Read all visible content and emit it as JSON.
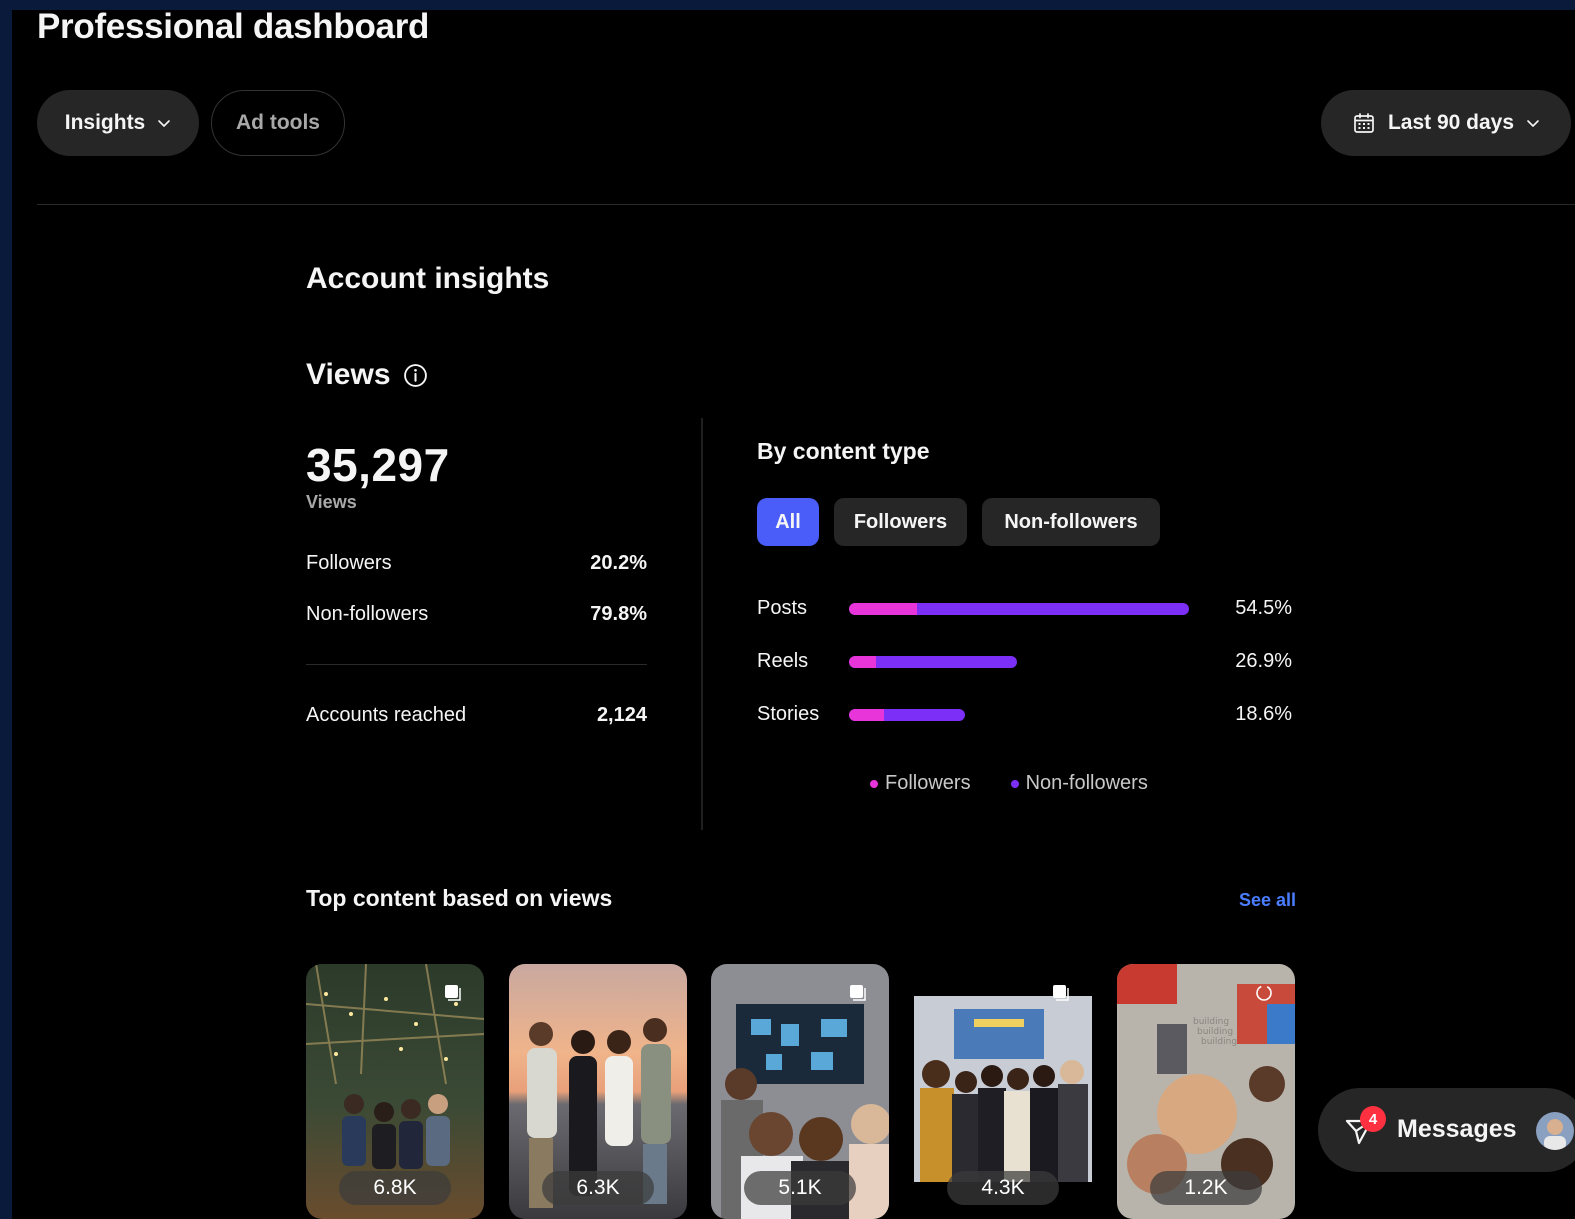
{
  "header": {
    "title": "Professional dashboard"
  },
  "nav": {
    "insights_label": "Insights",
    "ad_tools_label": "Ad tools",
    "date_range_label": "Last 90 days"
  },
  "account_insights": {
    "heading": "Account insights"
  },
  "views": {
    "heading": "Views",
    "total": "35,297",
    "total_label": "Views",
    "rows": [
      {
        "label": "Followers",
        "value": "20.2%"
      },
      {
        "label": "Non-followers",
        "value": "79.8%"
      }
    ],
    "reached": {
      "label": "Accounts reached",
      "value": "2,124"
    }
  },
  "by_content_type": {
    "heading": "By content type",
    "filters": [
      {
        "label": "All",
        "active": true
      },
      {
        "label": "Followers",
        "active": false
      },
      {
        "label": "Non-followers",
        "active": false
      }
    ],
    "rows": [
      {
        "label": "Posts",
        "value": "54.5%",
        "percent": 54.5,
        "followers_share": 0.2
      },
      {
        "label": "Reels",
        "value": "26.9%",
        "percent": 26.9,
        "followers_share": 0.16
      },
      {
        "label": "Stories",
        "value": "18.6%",
        "percent": 18.6,
        "followers_share": 0.3
      }
    ],
    "legend": [
      {
        "label": "Followers",
        "color": "#e835d9"
      },
      {
        "label": "Non-followers",
        "color": "#7b2ff7"
      }
    ]
  },
  "top_content": {
    "heading": "Top content based on views",
    "see_all_label": "See all",
    "items": [
      {
        "count": "6.8K",
        "type_icon": "carousel-icon"
      },
      {
        "count": "6.3K",
        "type_icon": ""
      },
      {
        "count": "5.1K",
        "type_icon": "carousel-icon"
      },
      {
        "count": "4.3K",
        "type_icon": "carousel-icon"
      },
      {
        "count": "1.2K",
        "type_icon": "reel-icon"
      }
    ]
  },
  "messages": {
    "label": "Messages",
    "badge": "4"
  },
  "colors": {
    "accent": "#4a5df9",
    "link": "#4a7dff",
    "followers": "#e835d9",
    "non_followers": "#7b2ff7",
    "badge": "#ff3040"
  }
}
